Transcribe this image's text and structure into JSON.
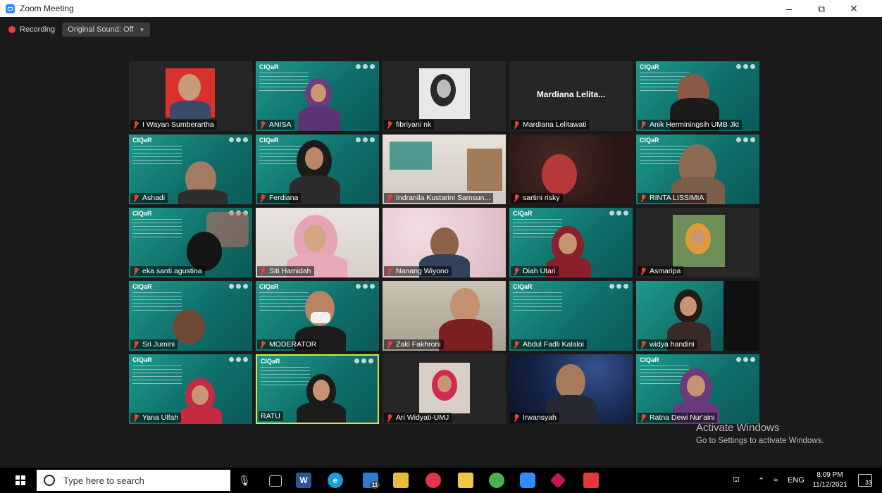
{
  "window": {
    "title": "Zoom Meeting",
    "controls": {
      "minimize": "–",
      "maximize": "⧉",
      "close": "✕"
    }
  },
  "meeting": {
    "recording_label": "Recording",
    "original_sound_label": "Original Sound: Off"
  },
  "tile_logo_text": "CIQaR",
  "participants": [
    "I Wayan Sumberartha",
    "ANISA",
    "fibriyani nk",
    "Mardiana Lelitawati",
    "Anik Herminingsih UMB Jkt",
    "Ashadi",
    "Ferdiana",
    "Indranila Kustarini Samsun...",
    "sartini risky",
    "RINTA LISSIMIA",
    "eka santi agustina",
    "Siti Hamidah",
    "Nanang Wiyono",
    "Diah Utari",
    "Asmaripa",
    "Sri Jumini",
    "MODERATOR",
    "Zaki Fakhroni",
    "Abdul Fadli Kalaloi",
    "widya handini",
    "Yana Ulfah",
    "RATU",
    "Ari Widyati-UMJ",
    "Irwansyah",
    "Ratna Dewi Nur'aini"
  ],
  "placeholder_name": "Mardiana  Lelita...",
  "watermark": {
    "line1": "Activate Windows",
    "line2": "Go to Settings to activate Windows."
  },
  "taskbar": {
    "search_placeholder": "Type here to search",
    "app_badge": "11",
    "language": "ENG",
    "time": "8:09 PM",
    "date": "11/12/2021",
    "notification_count": "33"
  },
  "colors": {
    "active_speaker": "#d7e44b",
    "mute": "#e8403a",
    "zoom_blue": "#2d8cff"
  }
}
